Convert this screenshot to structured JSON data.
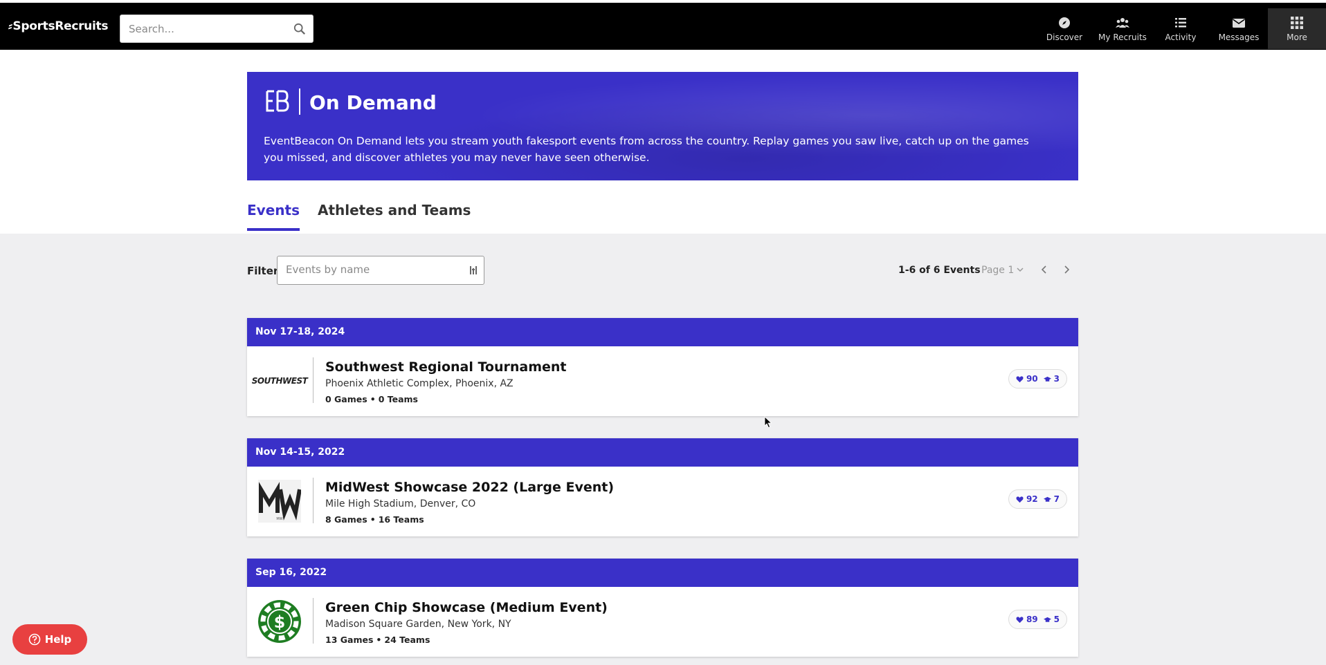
{
  "nav": {
    "logo": "SportsRecruits",
    "logo_mark": "⸗",
    "search_placeholder": "Search...",
    "items": [
      {
        "label": "Discover",
        "icon": "compass-icon"
      },
      {
        "label": "My Recruits",
        "icon": "users-icon"
      },
      {
        "label": "Activity",
        "icon": "list-icon"
      },
      {
        "label": "Messages",
        "icon": "envelope-icon"
      },
      {
        "label": "More",
        "icon": "grid-icon",
        "active": true
      }
    ]
  },
  "banner": {
    "title": "On Demand",
    "description": "EventBeacon On Demand lets you stream youth fakesport events from across the country. Replay games you saw live, catch up on the games you missed, and discover athletes you may never have seen otherwise.",
    "color": "#3a30c8"
  },
  "tabs": [
    {
      "label": "Events",
      "active": true
    },
    {
      "label": "Athletes and Teams",
      "active": false
    }
  ],
  "filter": {
    "label": "Filter",
    "placeholder": "Events by name"
  },
  "pager": {
    "count": "1-6 of 6 Events",
    "page": "Page 1"
  },
  "events": [
    {
      "date": "Nov 17-18, 2024",
      "logo": "SOUTHWEST",
      "title": "Southwest Regional Tournament",
      "location": "Phoenix Athletic Complex, Phoenix, AZ",
      "games": "0 Games",
      "teams": "0 Teams",
      "likes": "90",
      "recruits": "3"
    },
    {
      "date": "Nov 14-15, 2022",
      "logo": "MW",
      "title": "MidWest Showcase 2022 (Large Event)",
      "location": "Mile High Stadium, Denver, CO",
      "games": "8 Games",
      "teams": "16 Teams",
      "likes": "92",
      "recruits": "7"
    },
    {
      "date": "Sep 16, 2022",
      "logo": "$",
      "title": "Green Chip Showcase (Medium Event)",
      "location": "Madison Square Garden, New York, NY",
      "games": "13 Games",
      "teams": "24 Teams",
      "likes": "89",
      "recruits": "5"
    }
  ],
  "help": {
    "label": "Help",
    "color": "#e84040"
  }
}
